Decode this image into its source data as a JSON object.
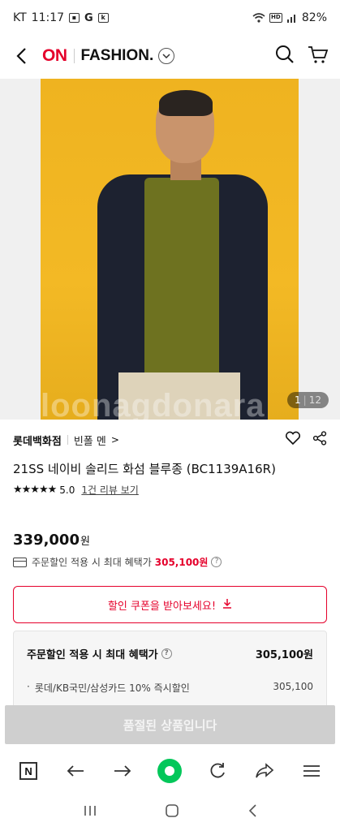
{
  "status_bar": {
    "carrier": "KT",
    "time": "11:17",
    "icons_left": [
      "gallery-icon",
      "google-icon",
      "kt-icon"
    ],
    "icons_right": [
      "wifi-icon",
      "hd-icon",
      "signal-icon"
    ],
    "battery": "82%"
  },
  "header": {
    "logo_on": "ON",
    "logo_fashion": "FASHION.",
    "icons": [
      "back-arrow-icon",
      "chevron-down-icon",
      "search-icon",
      "cart-icon"
    ]
  },
  "hero": {
    "watermark": "loonagdonara",
    "counter_current": "1",
    "counter_total": "12"
  },
  "product": {
    "store": "롯데백화점",
    "brand": "빈폴 멘",
    "brand_arrow": ">",
    "title": "21SS 네이비 솔리드 화섬 블루종 (BC1139A16R)",
    "stars": "★★★★★",
    "rating": "5.0",
    "review_link": "1건 리뷰 보기",
    "price": "339,000",
    "price_unit": "원",
    "max_benefit_label": "주문할인 적용 시 최대 혜택가",
    "max_benefit_amount": "305,100원"
  },
  "coupon": {
    "label": "할인 쿠폰을 받아보세요!"
  },
  "benefit_box": {
    "title": "주문할인 적용 시 최대 혜택가",
    "amount": "305,100원",
    "row_label": "롯데/KB국민/삼성카드 10% 즉시할인",
    "row_amount": "305,100"
  },
  "soldout": {
    "label": "품절된 상품입니다"
  },
  "browser_nav": {
    "n_logo": "N"
  },
  "colors": {
    "brand_red": "#e5002b",
    "naver_green": "#03c75a",
    "hero_yellow": "#efb320"
  }
}
